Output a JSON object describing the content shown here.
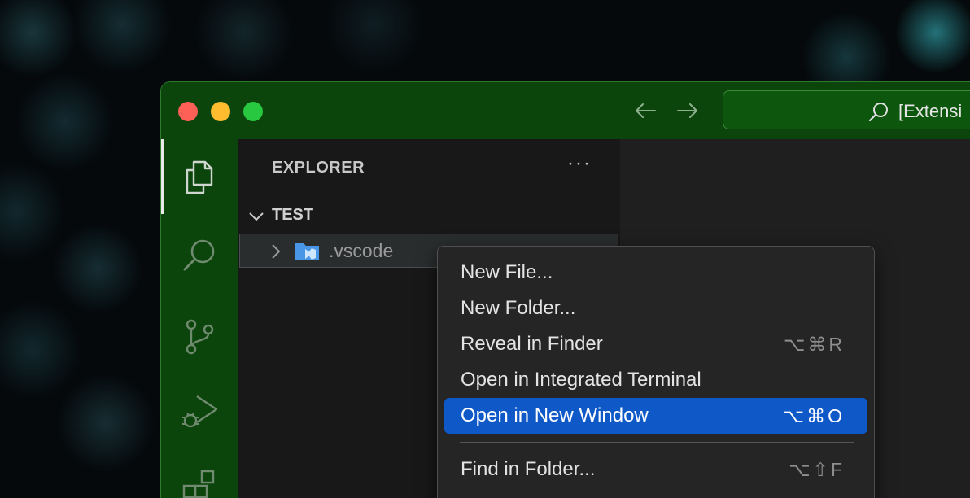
{
  "window": {
    "command_center_text": "[Extensi"
  },
  "sidebar": {
    "title": "EXPLORER",
    "more_label": "···",
    "section_label": "TEST",
    "tree": [
      {
        "label": ".vscode"
      }
    ]
  },
  "context_menu": {
    "items": [
      {
        "label": "New File...",
        "shortcut": ""
      },
      {
        "label": "New Folder...",
        "shortcut": ""
      },
      {
        "label": "Reveal in Finder",
        "shortcut": "⌥⌘R"
      },
      {
        "label": "Open in Integrated Terminal",
        "shortcut": ""
      },
      {
        "label": "Open in New Window",
        "shortcut": "⌥⌘O",
        "selected": true
      },
      {
        "label": "Find in Folder...",
        "shortcut": "⌥⇧F"
      }
    ]
  },
  "icons": {
    "back": "arrow-left-icon",
    "forward": "arrow-right-icon",
    "search": "search-icon",
    "files": "files-icon",
    "source_control": "source-control-icon",
    "run_debug": "run-debug-icon",
    "extensions": "extensions-icon",
    "new_file": "new-file-icon",
    "new_folder": "new-folder-icon",
    "refresh": "refresh-icon",
    "collapse": "collapse-all-icon",
    "folder": "vscode-folder-icon"
  },
  "colors": {
    "titlebar": "#0b450b",
    "selection": "#0e58c8",
    "sidebar": "#181818",
    "menu": "#252526"
  }
}
